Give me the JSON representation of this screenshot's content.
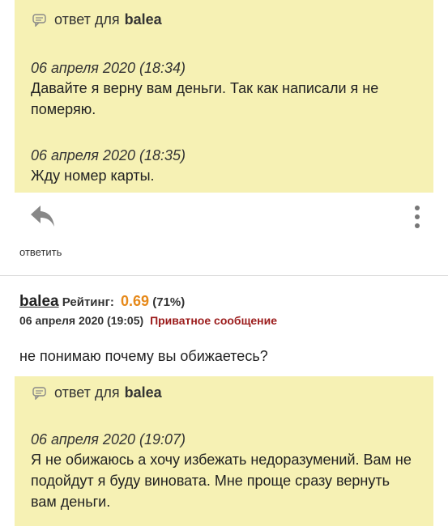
{
  "reply1": {
    "prefix": "ответ для",
    "user": "balea",
    "entries": [
      {
        "time": "06 апреля 2020 (18:34)",
        "text": "Давайте я верну вам деньги. Так как написали я не померяю."
      },
      {
        "time": "06 апреля 2020 (18:35)",
        "text": "Жду номер карты."
      }
    ]
  },
  "actions": {
    "reply_label": "ответить"
  },
  "post": {
    "username": "balea",
    "rating_label": "Рейтинг:",
    "rating_value": "0.69",
    "rating_percent": "(71%)",
    "date": "06 апреля 2020 (19:05)",
    "private_message": "Приватное сообщение",
    "body": "не понимаю почему вы обижаетесь?"
  },
  "reply2": {
    "prefix": "ответ для",
    "user": "balea",
    "entries": [
      {
        "time": "06 апреля 2020 (19:07)",
        "text": "Я не обижаюсь а хочу избежать недоразумений. Вам не подойдут я буду виновата. Мне проще сразу вернуть вам деньги."
      }
    ]
  },
  "colors": {
    "quote_bg": "#f6f1b4",
    "rating": "#e6891a",
    "pm_link": "#9b1b1b"
  }
}
